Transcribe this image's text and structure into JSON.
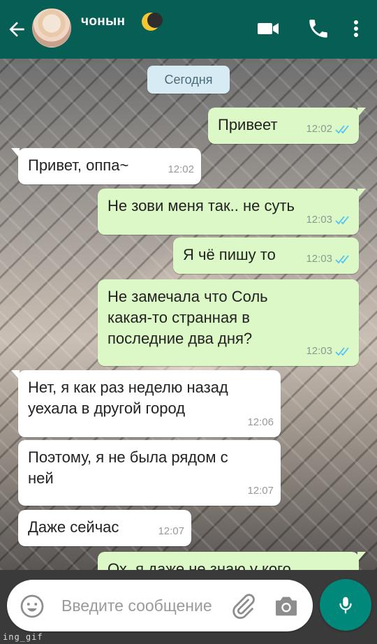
{
  "header": {
    "contact_name": "чонын",
    "accent": "#075e54",
    "icons": [
      "back-arrow-icon",
      "avatar",
      "crescent-moon-icon",
      "video-call-icon",
      "phone-icon",
      "more-vert-icon"
    ]
  },
  "date_chip": "Сегодня",
  "messages": [
    {
      "dir": "out",
      "text": "Привеет",
      "time": "12:02",
      "read": true
    },
    {
      "dir": "in",
      "text": "Привет, оппа~",
      "time": "12:02"
    },
    {
      "dir": "out",
      "text": "Не зови меня так.. не суть",
      "time": "12:03",
      "read": true
    },
    {
      "dir": "out",
      "text": "Я чё пишу то",
      "time": "12:03",
      "read": true
    },
    {
      "dir": "out",
      "text": "Не замечала что Соль какая-то странная в последние два дня?",
      "time": "12:03",
      "read": true
    },
    {
      "dir": "in",
      "text": "Нет, я как раз неделю назад уехала в другой город",
      "time": "12:06"
    },
    {
      "dir": "in",
      "text": "Поэтому, я не была рядом с ней",
      "time": "12:07"
    },
    {
      "dir": "in",
      "text": "Даже сейчас",
      "time": "12:07"
    },
    {
      "dir": "out",
      "text": "Ох, я даже не знаю у кого",
      "time": ""
    }
  ],
  "composer": {
    "placeholder": "Введите сообщение",
    "icons": [
      "emoji-icon",
      "attach-icon",
      "camera-icon",
      "mic-icon"
    ]
  },
  "watermark": "ing_gif",
  "colors": {
    "outgoing_bubble": "#dcf8c6",
    "incoming_bubble": "#ffffff",
    "read_ticks": "#4fc3f7",
    "mic_button": "#00897b"
  }
}
